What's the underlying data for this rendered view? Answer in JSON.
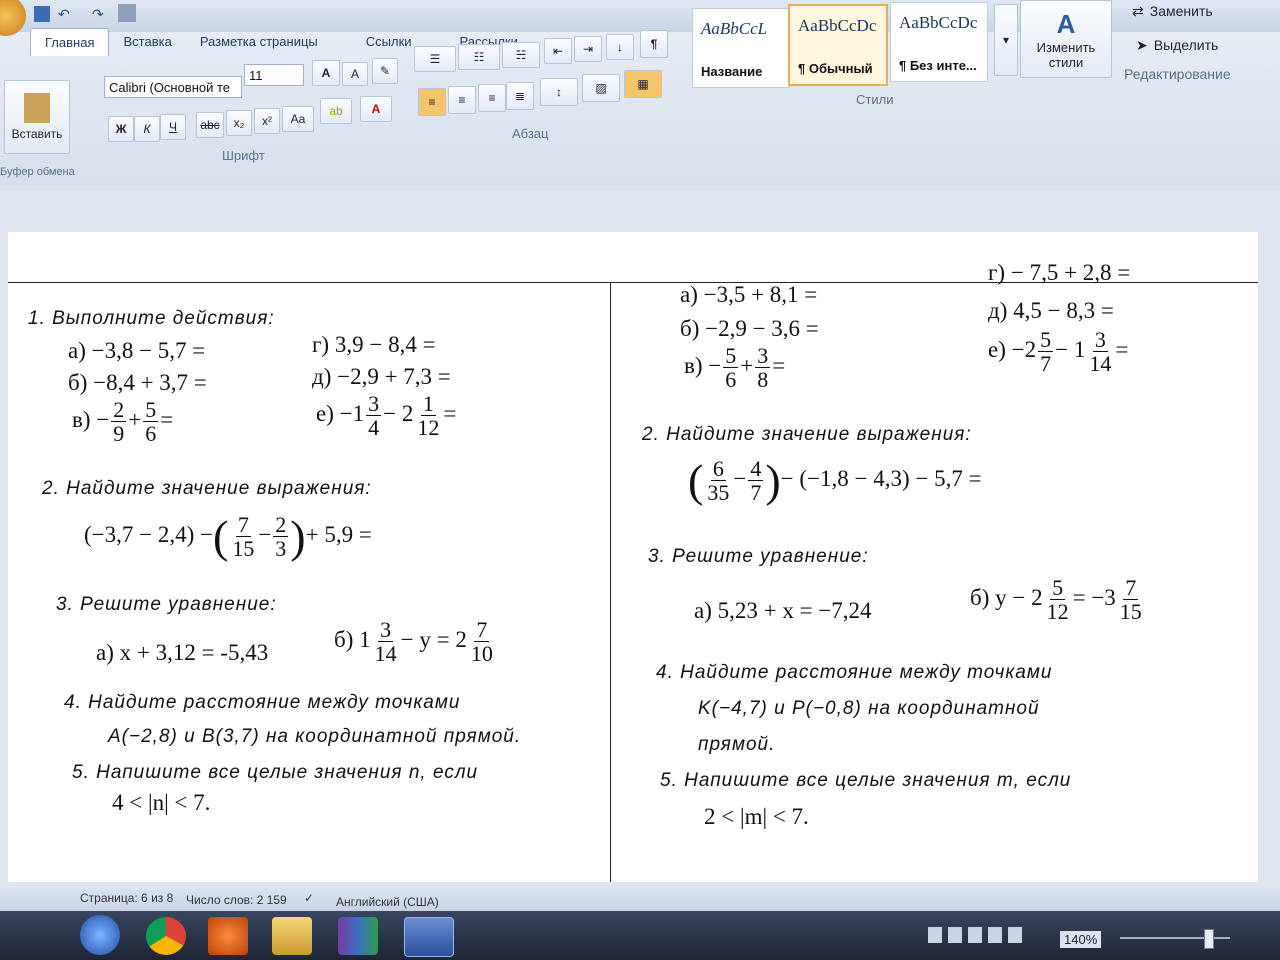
{
  "ribbon": {
    "tabs": [
      "Главная",
      "Вставка",
      "Разметка страницы",
      "Ссылки",
      "Рассылки"
    ],
    "font_name": "Calibri (Основной те",
    "font_size": "11",
    "paste_label": "Вставить",
    "groups": {
      "clipboard": "Буфер обмена",
      "font": "Шрифт",
      "paragraph": "Абзац",
      "styles": "Стили",
      "editing": "Редактирование"
    },
    "styles": [
      {
        "sample": "AaBbCcL",
        "name": "Название"
      },
      {
        "sample": "AaBbCcDc",
        "name": "¶ Обычный"
      },
      {
        "sample": "AaBbCcDc",
        "name": "¶ Без инте..."
      }
    ],
    "change_styles": "Изменить стили",
    "replace": "Заменить",
    "select": "Выделить"
  },
  "doc": {
    "left": {
      "t1": "1. Выполните действия:",
      "a": "а) −3,8 − 5,7 =",
      "b": "б) −8,4 + 3,7 =",
      "v_prefix": "в) −",
      "g": "г) 3,9 − 8,4 =",
      "d": "д) −2,9 + 7,3 =",
      "e_prefix": "е) −1",
      "t2": "2. Найдите значение выражения:",
      "expr2_a": "(−3,7 − 2,4) −",
      "expr2_b": "+ 5,9 =",
      "t3": "3. Решите уравнение:",
      "eq_a": "а)  x + 3,12 = -5,43",
      "eq_b_prefix": "б)  1",
      "eq_b_mid": "− y = 2",
      "t4": "4. Найдите расстояние между точками",
      "t4b": "A(−2,8)  и  B(3,7) на координатной прямой.",
      "t5": "5. Напишите все целые значения n, если",
      "t5b": "4 < |n| < 7."
    },
    "right": {
      "a": "а) −3,5 + 8,1 =",
      "b": "б) −2,9 − 3,6 =",
      "v_prefix": "в) −",
      "g": "г) − 7,5 + 2,8 =",
      "d": "д) 4,5 − 8,3 =",
      "e_prefix": "е) −2",
      "t2": "2. Найдите значение выражения:",
      "expr2_b": "− (−1,8 − 4,3) − 5,7 =",
      "t3": "3. Решите уравнение:",
      "eq_a": "а)  5,23 + x = −7,24",
      "eq_b_prefix": "б)  y − 2",
      "eq_b_mid": "= −3",
      "t4": "4. Найдите расстояние между точками",
      "t4b": "K(−4,7)  и  P(−0,8) на координатной",
      "t4c": "прямой.",
      "t5": "5. Напишите все целые значения m, если",
      "t5b": "2 < |m| < 7."
    },
    "fractions": {
      "l_v1": [
        "2",
        "9"
      ],
      "l_v2": [
        "5",
        "6"
      ],
      "l_e1": [
        "3",
        "4"
      ],
      "l_e2": [
        "1",
        "12"
      ],
      "l_x1": [
        "7",
        "15"
      ],
      "l_x2": [
        "2",
        "3"
      ],
      "l_q1": [
        "3",
        "14"
      ],
      "l_q2": [
        "7",
        "10"
      ],
      "r_v1": [
        "5",
        "6"
      ],
      "r_v2": [
        "3",
        "8"
      ],
      "r_e1": [
        "5",
        "7"
      ],
      "r_e2": [
        "3",
        "14"
      ],
      "r_x1": [
        "6",
        "35"
      ],
      "r_x2": [
        "4",
        "7"
      ],
      "r_q1": [
        "5",
        "12"
      ],
      "r_q2": [
        "7",
        "15"
      ]
    }
  },
  "status": {
    "page": "Страница: 6 из 8",
    "words": "Число слов: 2 159",
    "lang": "Английский (США)",
    "zoom": "140%"
  }
}
